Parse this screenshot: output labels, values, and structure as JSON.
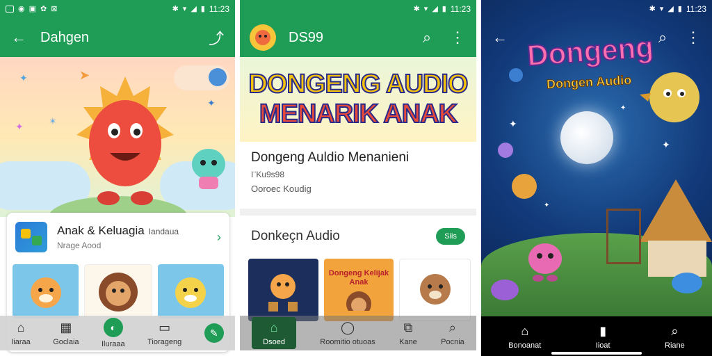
{
  "screens": {
    "left": {
      "status": {
        "time": "11:23"
      },
      "appbar": {
        "back_icon": "arrow-left-icon",
        "title": "Dahgen",
        "share_icon": "share-icon"
      },
      "app": {
        "name": "Anak & Keluagia",
        "tag": "Iandaua",
        "subtitle": "Nrage Aood"
      },
      "nav": [
        {
          "label": "Iiaraa",
          "icon": "home-icon"
        },
        {
          "label": "Goclaia",
          "icon": "grid-icon"
        },
        {
          "label": "Iluraaa",
          "icon": "green-circle-icon"
        },
        {
          "label": "Tiorageng",
          "icon": "screen-icon"
        }
      ]
    },
    "middle": {
      "status": {
        "time": "11:23"
      },
      "appbar": {
        "title": "DS99",
        "search_icon": "search-icon",
        "more_icon": "more-vert-icon"
      },
      "banner": {
        "line1": "DONGENG AUDIO",
        "line2": "MENARIK ANAK"
      },
      "details": {
        "title": "Dongeng Auldio Menanieni",
        "line2": "I¨Ku9s98",
        "line3": "Ooroec Koudig"
      },
      "section": {
        "title": "Donkeçn Audio",
        "pill": "Siis"
      },
      "card_text": "Dongeng Kelijak Anak",
      "nav": [
        {
          "label": "Dsoed",
          "icon": "home-icon"
        },
        {
          "label": "Roomitio otuoas",
          "icon": "circle-icon"
        },
        {
          "label": "Kane",
          "icon": "puzzle-icon"
        },
        {
          "label": "Pocnia",
          "icon": "search-icon"
        }
      ]
    },
    "right": {
      "status": {
        "time": "11:23"
      },
      "appbar": {
        "back_icon": "arrow-left-icon",
        "search_icon": "search-icon",
        "more_icon": "more-vert-icon"
      },
      "title_big": "Dongeng",
      "title_small": "Dongen Audio",
      "nav": [
        {
          "label": "Bonoanat",
          "icon": "home-icon"
        },
        {
          "label": "Iioat",
          "icon": "phone-icon"
        },
        {
          "label": "Riane",
          "icon": "search-icon"
        }
      ]
    }
  },
  "colors": {
    "accent_green": "#1f9d57",
    "night_blue": "#0d2b5c"
  }
}
